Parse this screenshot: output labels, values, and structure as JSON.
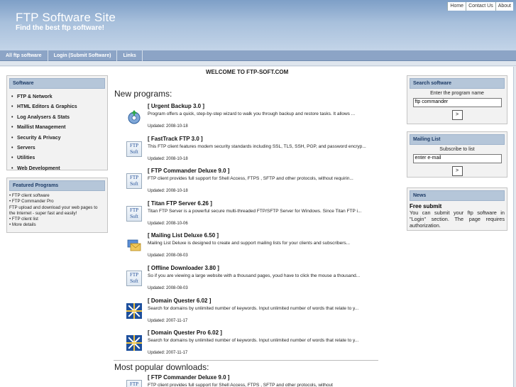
{
  "header": {
    "title": "FTP Software Site",
    "tagline": "Find the best ftp software!",
    "toplinks": [
      "Home",
      "Contact Us",
      "About"
    ]
  },
  "nav": [
    "All ftp software",
    "Login (Submit Software)",
    "Links"
  ],
  "sidebar": {
    "software_title": "Software",
    "software_items": [
      "FTP & Network",
      "HTML Editors & Graphics",
      "Log Analysers & Stats",
      "Maillist Management",
      "Security & Privacy",
      "Servers",
      "Utilities",
      "Web Development"
    ],
    "featured_title": "Featured Programs",
    "featured_lines": [
      "•  FTP client software",
      "•  FTP Commander Pro",
      "FTP upload and download your web pages to",
      "the Internet - super fast and easily!",
      "•  FTP client list",
      "•  More details"
    ]
  },
  "main": {
    "welcome": "WELCOME TO FTP-SOFT.COM",
    "new_programs_title": "New programs:",
    "popular_title": "Most popular downloads:",
    "new_programs": [
      {
        "title": "[ Urgent Backup 3.0 ]",
        "desc": "Program offers a quick, step-by-step wizard to walk you through backup and restore tasks. It allows ...",
        "date": "Updated: 2008-10-18",
        "icon": "disk-icon"
      },
      {
        "title": "[ FastTrack FTP 3.0 ]",
        "desc": "This FTP client features modem security standards including SSL, TLS, SSH, PGP, and password encryp...",
        "date": "Updated: 2008-10-18",
        "icon": "ftpsoft-icon"
      },
      {
        "title": "[ FTP Commander Deluxe 9.0 ]",
        "desc": "FTP client provides full support for Shell Access, FTPS , SFTP and other protocols, without requirin...",
        "date": "Updated: 2008-10-18",
        "icon": "ftpsoft-icon"
      },
      {
        "title": "[ Titan FTP Server 6.26 ]",
        "desc": "Titan FTP Server is a powerful secure multi-threaded FTP/SFTP Server for Windows. Since Titan FTP i...",
        "date": "Updated: 2008-10-06",
        "icon": "ftpsoft-icon"
      },
      {
        "title": "[ Mailing List Deluxe 6.50 ]",
        "desc": "Mailing List Deluxe is designed to create and support mailing lists for your clients and subscribers...",
        "date": "Updated: 2008-08-03",
        "icon": "mail-icon"
      },
      {
        "title": "[ Offline Downloader 3.80 ]",
        "desc": "So if you are viewing a large website with a thousand pages, youd have to click the mouse a thousand...",
        "date": "Updated: 2008-08-03",
        "icon": "ftpsoft-icon"
      },
      {
        "title": "[ Domain Quester 6.02 ]",
        "desc": "Search for domains by unlimited number of keywords. Input unlimited number of words that relate to y...",
        "date": "Updated: 2007-11-17",
        "icon": "star-icon"
      },
      {
        "title": "[ Domain Quester Pro 6.02 ]",
        "desc": "Search for domains by unlimited number of keywords. Input unlimited number of words that relate to y...",
        "date": "Updated: 2007-11-17",
        "icon": "star-icon"
      }
    ],
    "popular": [
      {
        "title": "[ FTP Commander Deluxe 9.0 ]",
        "desc": "FTP client provides full support for Shell Access, FTPS , SFTP and other protocols, without",
        "icon": "ftpsoft-icon"
      }
    ],
    "ftpsoft_icon_text": [
      "FTP",
      "Soft"
    ]
  },
  "right": {
    "search_title": "Search software",
    "search_label": "Enter the program name",
    "search_value": "ftp commander",
    "search_button": ">",
    "mailing_title": "Mailing List",
    "mailing_label": "Subscribe to list",
    "mailing_value": "enter e-mail",
    "mailing_button": ">",
    "news_title": "News",
    "news_heading": "Free submit",
    "news_text": "You can submit your ftp software in \"Login\" section. The page requires authorization."
  }
}
